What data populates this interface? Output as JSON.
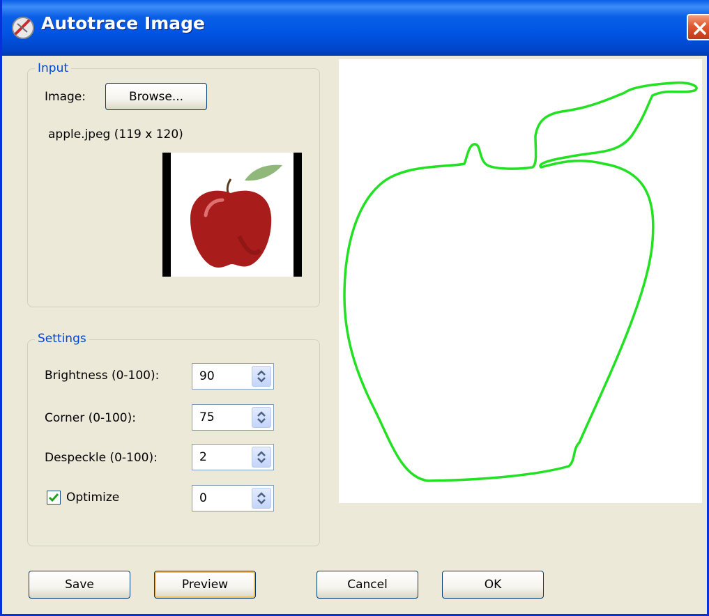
{
  "window": {
    "title": "Autotrace Image"
  },
  "input_group": {
    "legend": "Input",
    "image_label": "Image:",
    "browse_label": "Browse...",
    "file_info": "apple.jpeg (119 x 120)"
  },
  "settings_group": {
    "legend": "Settings",
    "brightness": {
      "label": "Brightness (0-100):",
      "value": "90"
    },
    "corner": {
      "label": "Corner (0-100):",
      "value": "75"
    },
    "despeckle": {
      "label": "Despeckle (0-100):",
      "value": "2"
    },
    "optimize": {
      "label": "Optimize",
      "value": "0",
      "checked": true
    }
  },
  "buttons": {
    "save": "Save",
    "preview": "Preview",
    "cancel": "Cancel",
    "ok": "OK"
  },
  "colors": {
    "trace_stroke": "#22e022",
    "titlebar": "#0054e3",
    "legend_text": "#0046d5"
  },
  "icons": {
    "title_icon": "autotrace-app-icon",
    "close": "close-icon"
  }
}
